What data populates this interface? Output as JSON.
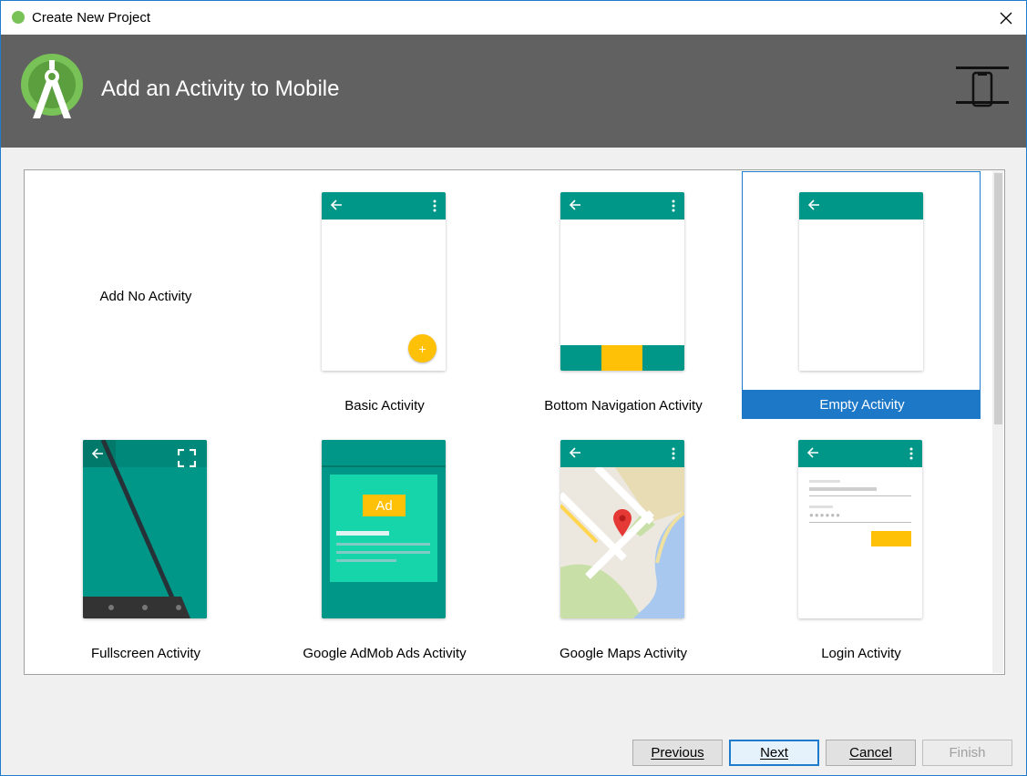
{
  "window": {
    "title": "Create New Project"
  },
  "header": {
    "heading": "Add an Activity to Mobile"
  },
  "templates": [
    {
      "label": "Add No Activity"
    },
    {
      "label": "Basic Activity"
    },
    {
      "label": "Bottom Navigation Activity"
    },
    {
      "label": "Empty Activity"
    },
    {
      "label": "Fullscreen Activity"
    },
    {
      "label": "Google AdMob Ads Activity"
    },
    {
      "label": "Google Maps Activity"
    },
    {
      "label": "Login Activity"
    }
  ],
  "selected_template": "Empty Activity",
  "admob": {
    "ad_badge": "Ad"
  },
  "fab": {
    "symbol": "+"
  },
  "buttons": {
    "previous": "Previous",
    "next": "Next",
    "cancel": "Cancel",
    "finish": "Finish"
  },
  "colors": {
    "teal": "#009688",
    "amber": "#ffc107",
    "selection": "#1e78c8",
    "header": "#616161"
  }
}
